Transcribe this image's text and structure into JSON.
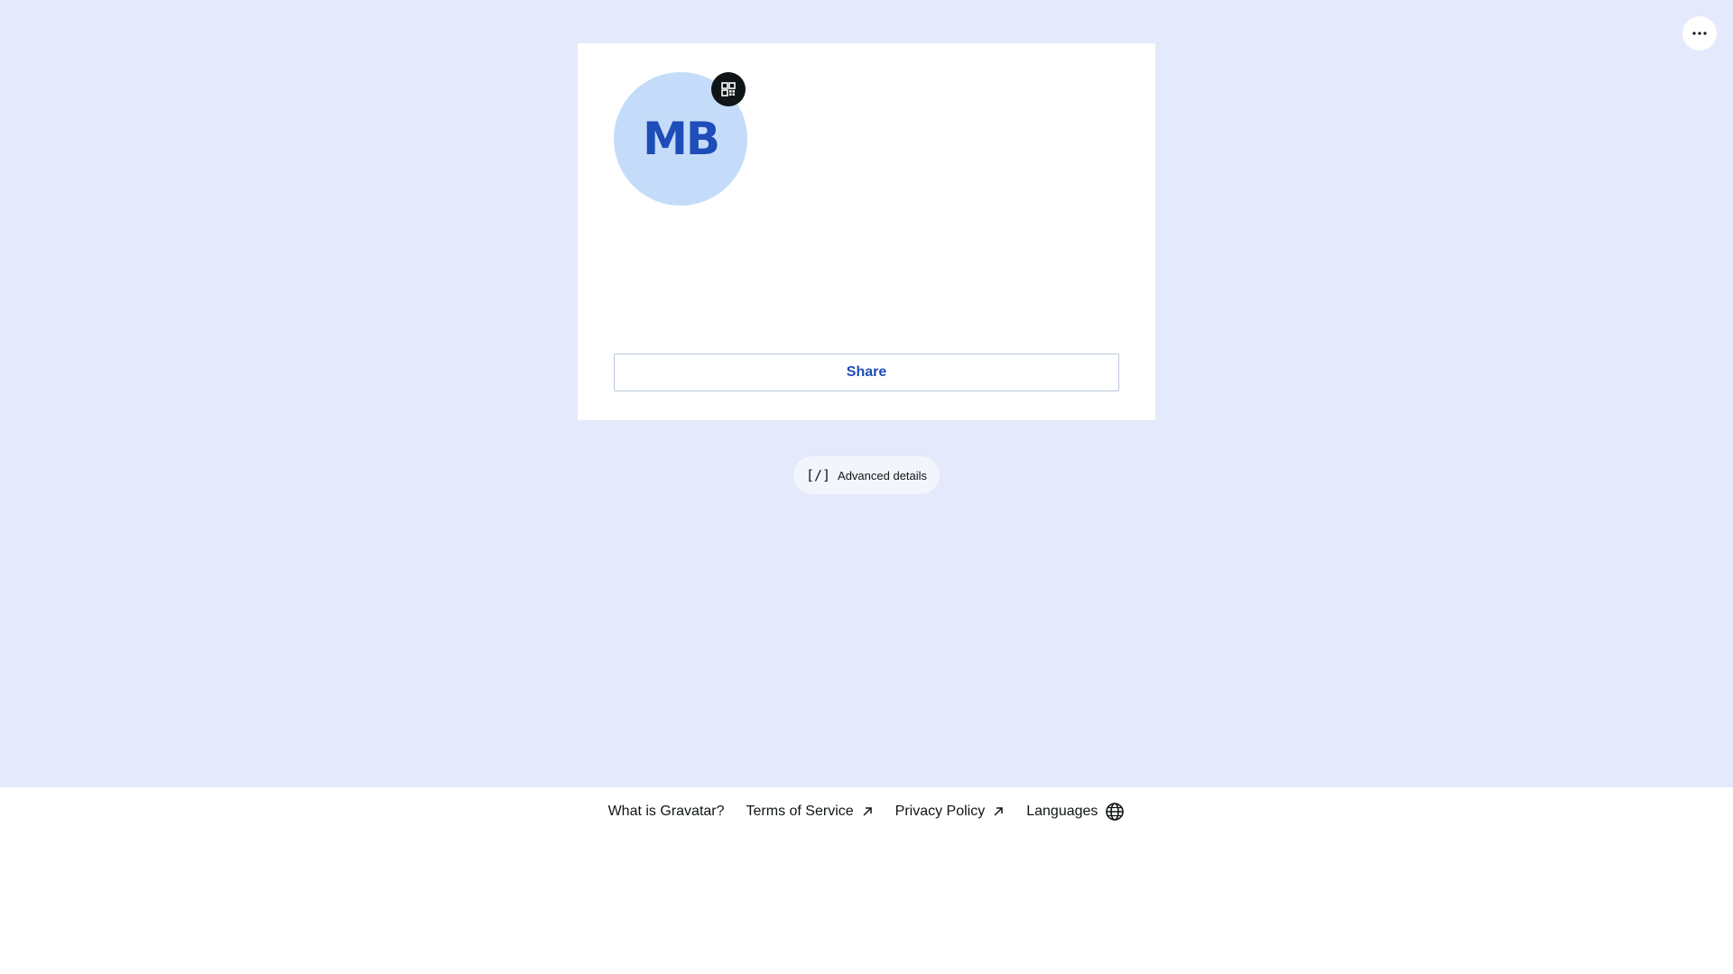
{
  "header": {
    "menu_icon": "more-horizontal-icon"
  },
  "profile": {
    "initials": "MB",
    "avatar_bg": "#c4dcf9",
    "initials_color": "#1e4cb8",
    "qr_icon": "qr-code-icon",
    "share_label": "Share"
  },
  "advanced": {
    "icon_glyph": "[/]",
    "label": "Advanced details"
  },
  "footer": {
    "links": [
      {
        "label": "What is Gravatar?",
        "icon": ""
      },
      {
        "label": "Terms of Service",
        "icon": "external-arrow-icon"
      },
      {
        "label": "Privacy Policy",
        "icon": "external-arrow-icon"
      },
      {
        "label": "Languages",
        "icon": "globe-icon"
      }
    ]
  },
  "colors": {
    "page_bg": "#e4e9fb",
    "card_bg": "#ffffff",
    "accent": "#1e4cb8",
    "text": "#101517"
  }
}
